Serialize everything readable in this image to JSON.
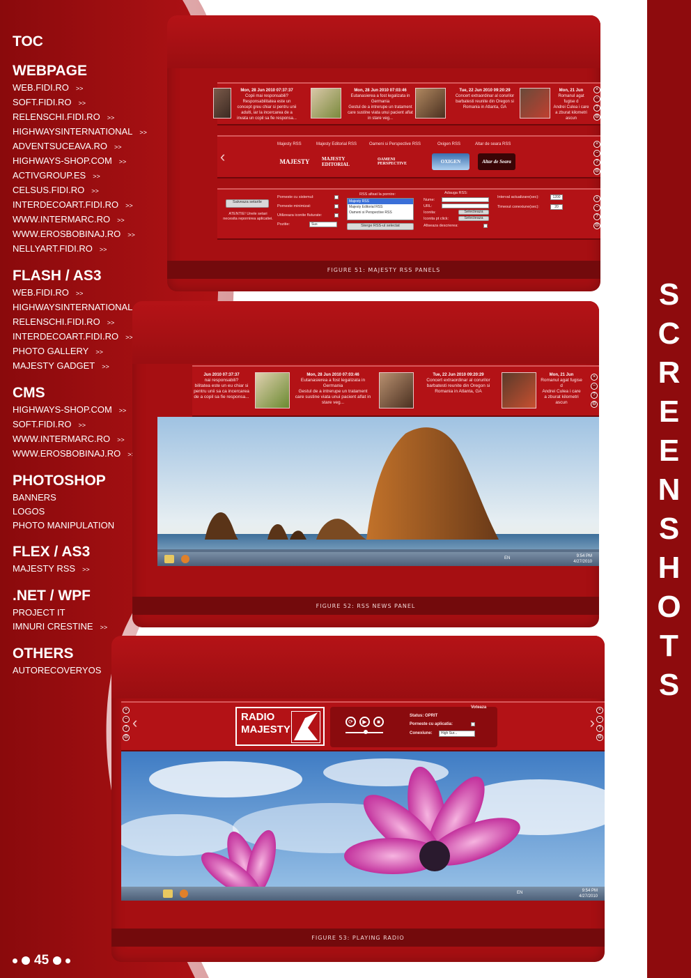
{
  "sidebar": {
    "toc_label": "TOC",
    "arrow": ">>",
    "sections": [
      {
        "title": "WEBPAGE",
        "links": [
          "WEB.FIDI.RO",
          "SOFT.FIDI.RO",
          "RELENSCHI.FIDI.RO",
          "HIGHWAYSINTERNATIONAL",
          "ADVENTSUCEAVA.RO",
          "HIGHWAYS-SHOP.COM",
          "ACTIVGROUP.ES",
          "CELSUS.FIDI.RO",
          "INTERDECOART.FIDI.RO",
          "WWW.INTERMARC.RO",
          "WWW.EROSBOBINAJ.RO",
          "NELLYART.FIDI.RO"
        ]
      },
      {
        "title": "FLASH / AS3",
        "links": [
          "WEB.FIDI.RO",
          "HIGHWAYSINTERNATIONAL",
          "RELENSCHI.FIDI.RO",
          "INTERDECOART.FIDI.RO",
          "PHOTO GALLERY",
          "MAJESTY GADGET"
        ]
      },
      {
        "title": "CMS",
        "links": [
          "HIGHWAYS-SHOP.COM",
          "SOFT.FIDI.RO",
          "WWW.INTERMARC.RO",
          "WWW.EROSBOBINAJ.RO"
        ]
      },
      {
        "title": "PHOTOSHOP",
        "items": [
          "BANNERS",
          "LOGOS",
          "PHOTO MANIPULATION"
        ]
      },
      {
        "title": "FLEX / AS3",
        "links": [
          "MAJESTY RSS"
        ]
      },
      {
        "title": ".NET / WPF",
        "items": [
          "PROJECT IT"
        ],
        "links": [
          "IMNURI CRESTINE"
        ]
      },
      {
        "title": "OTHERS",
        "items": [
          "AUTORECOVERYOS"
        ]
      }
    ]
  },
  "page_number": "45",
  "vertical_title": [
    "S",
    "C",
    "R",
    "E",
    "E",
    "N",
    "S",
    "H",
    "O",
    "T",
    "S"
  ],
  "figures": {
    "fig51": {
      "caption": "FIGURE 51: MAJESTY RSS PANELS",
      "news": [
        {
          "date": "Mon, 28 Jun 2010 07:37:37",
          "headline": "Copii mai responsabili?",
          "body": "Responsabilitatea este un concept greu chiar si pentru unii adulti, iar la incercarea de a invata un copil sa fie responsa..."
        },
        {
          "date": "Mon, 28 Jun 2010 07:03:46",
          "headline": "Eutanasierea a fost legalizata in Germania",
          "body": "Gestul de a intrerupe un tratament care sustine viata unui pacient aflat in stare veg..."
        },
        {
          "date": "Tue, 22 Jun 2010 09:20:29",
          "headline": "Concert extraordinar al corurilor barbatesti reunite din Oregon si Romania in Atlanta, GA",
          "body": ""
        },
        {
          "date": "Mon, 21 Jun",
          "headline": "Romanul agat fugise d",
          "body": "Andrei Culea i care a zburat kilometri ascun"
        }
      ],
      "rss_tabs": [
        "Majesty RSS",
        "Majesty Editorial RSS",
        "Oameni si Perspective RSS",
        "Oxigen RSS",
        "Altar de seara RSS"
      ],
      "rss_logos": [
        "MAJESTY",
        "MAJESTY EDITORIAL",
        "OAMENI PERSPECTIVE",
        "OXIGEN",
        "Altar de Seara"
      ],
      "settings": {
        "save_button": "Salveaza setarile",
        "warning": "ATENTIE! Unele setari necesita repornirea aplicatiei.",
        "start_with_system": "Porneste cu sistemul:",
        "start_minimized": "Porneste minimizat:",
        "use_faded_icons": "Utilizeaza iconite fluturate:",
        "position": "Pozitie:",
        "position_value": "Sus",
        "rss_list_label": "RSS afisat la pornire:",
        "rss_list": [
          "Majesty RSS",
          "Majesty Editorial RSS",
          "Oameni si Perspective RSS"
        ],
        "delete_button": "Sterge RSS-ul selectat",
        "add_rss": "Adauga RSS:",
        "name": "Nume:",
        "url": "URL:",
        "icon": "Iconita:",
        "icon_on_click": "Iconita pt click:",
        "select_button": "Selecteaza",
        "show_description": "Afiseaza descrierea:",
        "update_interval": "Interval actualizare(sec):",
        "update_value": "1200",
        "timeout": "Timeout conexiune(sec):",
        "timeout_value": "20"
      }
    },
    "fig52": {
      "caption": "FIGURE 52: RSS NEWS PANEL",
      "news": [
        {
          "date": "Jun 2010 07:37:37",
          "headline": "nai responsabili?",
          "body": "bilitatea este un eu chiar si pentru unii sa ca incercarea de a copil sa fie responsa..."
        },
        {
          "date": "Mon, 28 Jun 2010 07:03:46",
          "headline": "Eutanasierea a fost legalizata in Germania",
          "body": "Gestul de a intrerupe un tratament care sustine viata unui pacient aflat in stare veg..."
        },
        {
          "date": "Tue, 22 Jun 2010 09:20:29",
          "headline": "Concert extraordinar al corurilor barbatesti reunite din Oregon si Romania in Atlanta, GA",
          "body": ""
        },
        {
          "date": "Mon, 21 Jun",
          "headline": "Romanul agat fugise d",
          "body": "Andrei Culea i care a zburat kilometri ascun"
        }
      ],
      "taskbar": {
        "lang": "EN",
        "time": "9:54 PM",
        "date": "4/27/2010"
      }
    },
    "fig53": {
      "caption": "FIGURE 53: PLAYING RADIO",
      "radio_logo_line1": "RADIO",
      "radio_logo_line2": "MAJESTY",
      "vote": "Voteaza",
      "status_label": "Status: OPRIT",
      "start_with_app": "Porneste cu aplicatia:",
      "connection": "Conexiune:",
      "connection_value": "High Sur...",
      "taskbar": {
        "lang": "EN",
        "time": "9:54 PM",
        "date": "4/27/2010"
      }
    }
  },
  "colors": {
    "primary_red": "#a60f12",
    "dark_red": "#8e0b0d",
    "caption_bar": "#730a0c",
    "curve_pink": "#e8b8b8"
  }
}
